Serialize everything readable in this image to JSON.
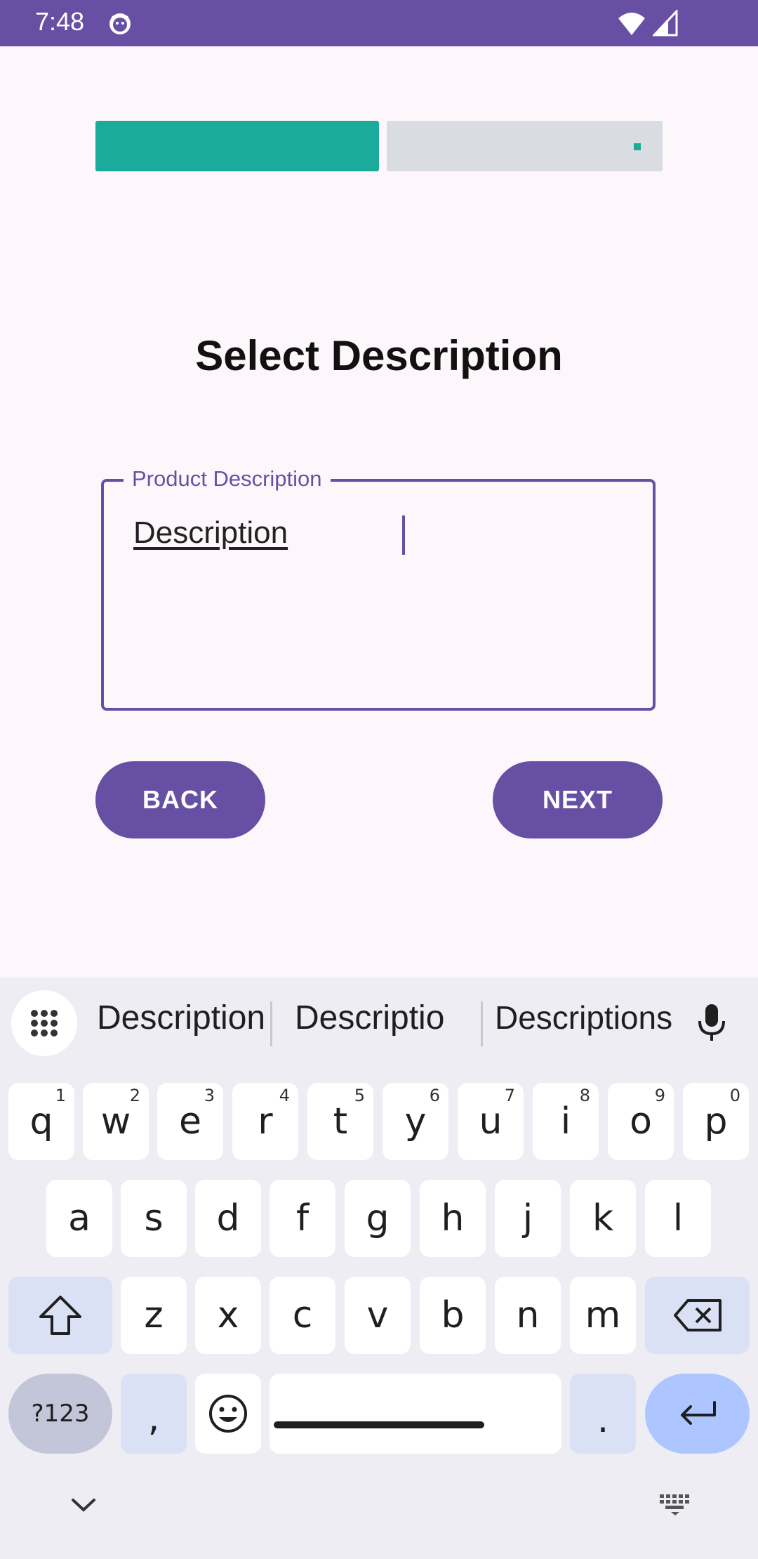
{
  "status_bar": {
    "time": "7:48"
  },
  "progress": {
    "value": 0.5
  },
  "page": {
    "title": "Select Description"
  },
  "field": {
    "label": "Product Description",
    "value": "Description"
  },
  "buttons": {
    "back": "BACK",
    "next": "NEXT"
  },
  "colors": {
    "primary": "#6750a4",
    "progress": "#1aab9b",
    "progress_track": "#d9dde1",
    "background": "#fdf7fc"
  },
  "keyboard": {
    "suggestions": [
      "Description",
      "Descriptio",
      "Descriptions"
    ],
    "row1": [
      "q",
      "w",
      "e",
      "r",
      "t",
      "y",
      "u",
      "i",
      "o",
      "p"
    ],
    "row1_nums": [
      "1",
      "2",
      "3",
      "4",
      "5",
      "6",
      "7",
      "8",
      "9",
      "0"
    ],
    "row2": [
      "a",
      "s",
      "d",
      "f",
      "g",
      "h",
      "j",
      "k",
      "l"
    ],
    "row3": [
      "z",
      "x",
      "c",
      "v",
      "b",
      "n",
      "m"
    ],
    "symbols_key": "?123",
    "comma_key": ",",
    "period_key": ".",
    "icons": [
      "apps-grid-icon",
      "mic-icon",
      "shift-icon",
      "backspace-icon",
      "emoji-icon",
      "enter-icon",
      "chevron-down-icon",
      "keyboard-icon"
    ]
  }
}
